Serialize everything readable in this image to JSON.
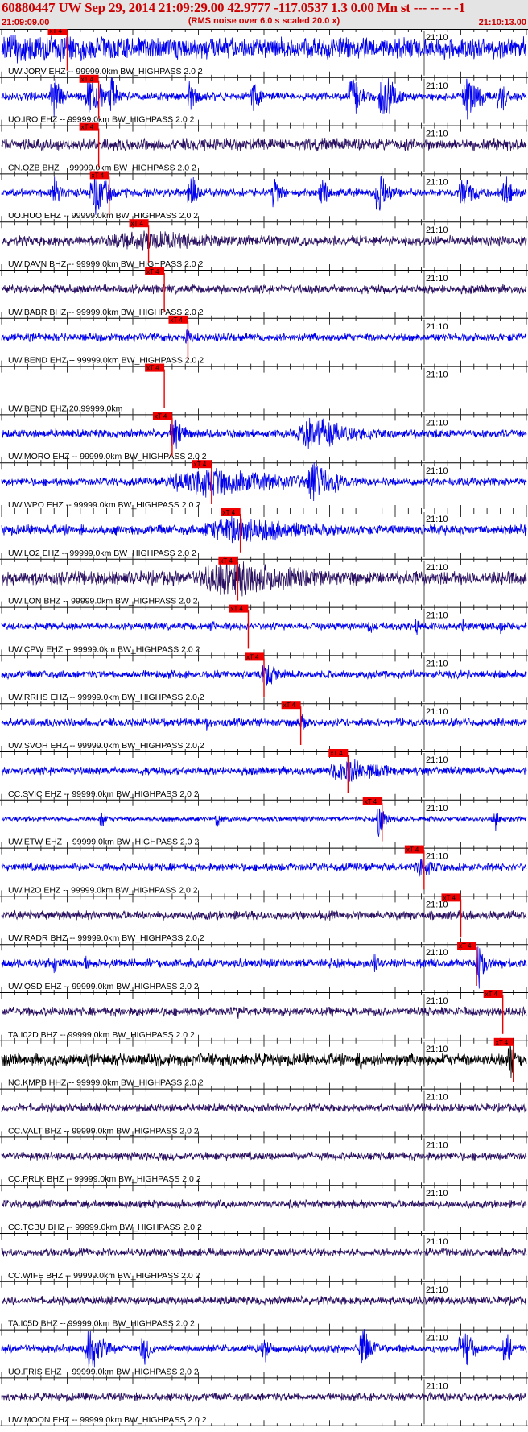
{
  "header": {
    "title": "60880447 UW Sep 29, 2014 21:09:29.00   42.9777 -117.0537  1.3 0.00 Mn st --- -- --  -1",
    "subtitle": "(RMS noise over 6.0 s scaled 20.0 x)",
    "start_time": "21:09:09.00",
    "end_time": "21:10:13.00"
  },
  "colors": {
    "trace_blue": "#0000ee",
    "trace_purple": "#2a1060",
    "trace_black": "#000000",
    "pick_red": "#ee0000",
    "title_red": "#cc0000"
  },
  "chart_data": {
    "type": "line",
    "title": "60880447 UW Sep 29, 2014 21:09:29.00   42.9777 -117.0537  1.3 0.00 Mn st --- -- --  -1",
    "subtitle": "(RMS noise over 6.0 s scaled 20.0 x)",
    "x_range": [
      "21:09:09.00",
      "21:10:13.00"
    ],
    "time_label": "21:10",
    "pick_label": "xT 4",
    "traces": [
      {
        "label": "UW.JORV EHZ -- 99999.0km BW_HIGHPASS  2.0  2",
        "color": "blue",
        "amp": 0.5,
        "pick": 0.125,
        "events": [
          [
            0.06,
            0.65,
            0.7
          ]
        ]
      },
      {
        "label": "UO.IRO EHZ -- 99999.0km BW_HIGHPASS  2.0  2",
        "color": "blue",
        "amp": 0.2,
        "pick": 0.185,
        "events": [
          [
            0.1,
            0.03,
            0.9
          ],
          [
            0.17,
            0.035,
            1.1
          ],
          [
            0.21,
            0.02,
            1.0
          ],
          [
            0.36,
            0.02,
            0.9
          ],
          [
            0.48,
            0.02,
            0.8
          ],
          [
            0.67,
            0.03,
            1.1
          ],
          [
            0.73,
            0.04,
            1.1
          ],
          [
            0.89,
            0.04,
            1.1
          ],
          [
            0.95,
            0.02,
            1.0
          ]
        ]
      },
      {
        "label": "CN.OZB BHZ -- 99999.0km BW_HIGHPASS  2.0  2",
        "color": "purple",
        "amp": 0.3,
        "pick": 0.185,
        "events": []
      },
      {
        "label": "UO.HUO EHZ -- 99999.0km BW_HIGHPASS  2.0  2",
        "color": "blue",
        "amp": 0.2,
        "pick": 0.205,
        "events": [
          [
            0.1,
            0.02,
            0.8
          ],
          [
            0.18,
            0.04,
            1.1
          ],
          [
            0.36,
            0.02,
            1.0
          ],
          [
            0.52,
            0.02,
            0.9
          ],
          [
            0.61,
            0.02,
            0.8
          ],
          [
            0.72,
            0.03,
            1.0
          ],
          [
            0.88,
            0.03,
            1.1
          ],
          [
            0.96,
            0.02,
            0.9
          ]
        ]
      },
      {
        "label": "UW.DAVN BHZ -- 99999.0km BW_HIGHPASS  2.0  2",
        "color": "purple",
        "amp": 0.25,
        "pick": 0.28,
        "events": [
          [
            0.28,
            0.3,
            0.5
          ]
        ]
      },
      {
        "label": "UW.BABR BHZ -- 99999.0km BW_HIGHPASS  2.0  2",
        "color": "purple",
        "amp": 0.22,
        "pick": 0.31,
        "events": []
      },
      {
        "label": "UW.BEND EHZ -- 99999.0km BW_HIGHPASS  2.0  2",
        "color": "blue",
        "amp": 0.2,
        "pick": 0.355,
        "events": [
          [
            0.355,
            0.02,
            0.5
          ]
        ]
      },
      {
        "label": "UW.BEND EHZ 20.99999.0km",
        "color": "blue",
        "amp": 0.0,
        "pick": 0.31,
        "events": []
      },
      {
        "label": "UW.MORO EHZ -- 99999.0km BW_HIGHPASS  2.0  2",
        "color": "blue",
        "amp": 0.2,
        "pick": 0.325,
        "events": [
          [
            0.33,
            0.03,
            0.8
          ],
          [
            0.6,
            0.12,
            0.8
          ]
        ]
      },
      {
        "label": "UW.WPO EHZ -- 99999.0km BW_HIGHPASS  2.0  2",
        "color": "blue",
        "amp": 0.2,
        "pick": 0.4,
        "events": [
          [
            0.4,
            0.3,
            0.7
          ],
          [
            0.6,
            0.06,
            1.1
          ]
        ]
      },
      {
        "label": "UW.LO2 EHZ -- 99999.0km BW_HIGHPASS  2.0  2",
        "color": "blue",
        "amp": 0.25,
        "pick": 0.455,
        "events": [
          [
            0.455,
            0.25,
            0.7
          ]
        ]
      },
      {
        "label": "UW.LON BHZ -- 99999.0km BW_HIGHPASS  2.0  2",
        "color": "purple",
        "amp": 0.35,
        "pick": 0.45,
        "events": [
          [
            0.45,
            0.25,
            0.9
          ]
        ]
      },
      {
        "label": "UW.CPW EHZ -- 99999.0km BW_HIGHPASS  2.0  2",
        "color": "blue",
        "amp": 0.18,
        "pick": 0.47,
        "events": [
          [
            0.4,
            0.01,
            0.5
          ],
          [
            0.7,
            0.01,
            0.6
          ],
          [
            0.79,
            0.01,
            0.7
          ],
          [
            0.88,
            0.01,
            0.5
          ],
          [
            0.95,
            0.01,
            0.5
          ]
        ]
      },
      {
        "label": "UW.RRHS EHZ -- 99999.0km BW_HIGHPASS  2.0  2",
        "color": "blue",
        "amp": 0.2,
        "pick": 0.5,
        "events": [
          [
            0.505,
            0.03,
            0.7
          ]
        ]
      },
      {
        "label": "UW.SVOH EHZ -- 99999.0km BW_HIGHPASS  2.0  2",
        "color": "blue",
        "amp": 0.2,
        "pick": 0.57,
        "events": [
          [
            0.39,
            0.01,
            0.5
          ],
          [
            0.57,
            0.03,
            0.5
          ]
        ]
      },
      {
        "label": "CC.SVIC EHZ -- 99999.0km BW_HIGHPASS  2.0  2",
        "color": "blue",
        "amp": 0.2,
        "pick": 0.66,
        "events": [
          [
            0.66,
            0.12,
            0.6
          ]
        ]
      },
      {
        "label": "UW.ETW EHZ -- 99999.0km BW_HIGHPASS  2.0  2",
        "color": "blue",
        "amp": 0.12,
        "pick": 0.725,
        "events": [
          [
            0.19,
            0.01,
            0.7
          ],
          [
            0.41,
            0.01,
            0.8
          ],
          [
            0.72,
            0.02,
            0.9
          ],
          [
            0.94,
            0.01,
            0.8
          ]
        ]
      },
      {
        "label": "UW.H2O EHZ -- 99999.0km BW_HIGHPASS  2.0  2",
        "color": "blue",
        "amp": 0.2,
        "pick": 0.805,
        "events": [
          [
            0.8,
            0.05,
            0.5
          ]
        ]
      },
      {
        "label": "UW.RADR BHZ -- 99999.0km BW_HIGHPASS  2.0  2",
        "color": "purple",
        "amp": 0.22,
        "pick": 0.875,
        "events": []
      },
      {
        "label": "UW.OSD EHZ -- 99999.0km BW_HIGHPASS  2.0  2",
        "color": "blue",
        "amp": 0.22,
        "pick": 0.905,
        "events": [
          [
            0.1,
            0.01,
            0.6
          ],
          [
            0.16,
            0.01,
            0.6
          ],
          [
            0.71,
            0.01,
            0.7
          ],
          [
            0.91,
            0.02,
            1.1
          ]
        ]
      },
      {
        "label": "TA.I02D BHZ -- 99999.0km BW_HIGHPASS  2.0  2",
        "color": "purple",
        "amp": 0.22,
        "pick": 0.955,
        "events": [
          [
            0.45,
            0.01,
            0.5
          ]
        ]
      },
      {
        "label": "NC.KMPB HHZ -- 99999.0km BW_HIGHPASS  2.0  2",
        "color": "black",
        "amp": 0.3,
        "pick": 0.975,
        "events": [
          [
            0.685,
            0.01,
            0.7
          ],
          [
            0.97,
            0.02,
            0.9
          ]
        ]
      },
      {
        "label": "CC.VALT BHZ -- 99999.0km BW_HIGHPASS  2.0  2",
        "color": "purple",
        "amp": 0.2,
        "pick": null,
        "events": []
      },
      {
        "label": "CC.PRLK BHZ -- 99999.0km BW_HIGHPASS  2.0  2",
        "color": "purple",
        "amp": 0.2,
        "pick": null,
        "events": []
      },
      {
        "label": "CC.TCBU BHZ -- 99999.0km BW_HIGHPASS  2.0  2",
        "color": "purple",
        "amp": 0.2,
        "pick": null,
        "events": []
      },
      {
        "label": "CC.WIFE BHZ -- 99999.0km BW_HIGHPASS  2.0  2",
        "color": "purple",
        "amp": 0.2,
        "pick": null,
        "events": []
      },
      {
        "label": "TA.I05D BHZ -- 99999.0km BW_HIGHPASS  2.0  2",
        "color": "purple",
        "amp": 0.2,
        "pick": null,
        "events": []
      },
      {
        "label": "UO.FRIS EHZ -- 99999.0km BW_HIGHPASS  2.0  2",
        "color": "blue",
        "amp": 0.2,
        "pick": null,
        "events": [
          [
            0.17,
            0.04,
            1.1
          ],
          [
            0.27,
            0.02,
            0.9
          ],
          [
            0.5,
            0.02,
            0.8
          ],
          [
            0.69,
            0.03,
            1.0
          ],
          [
            0.88,
            0.03,
            1.1
          ],
          [
            0.96,
            0.02,
            1.0
          ]
        ]
      },
      {
        "label": "UW.MOON EHZ -- 99999.0km BW_HIGHPASS  2.0  2",
        "color": "purple",
        "amp": 0.2,
        "pick": null,
        "events": []
      }
    ]
  }
}
